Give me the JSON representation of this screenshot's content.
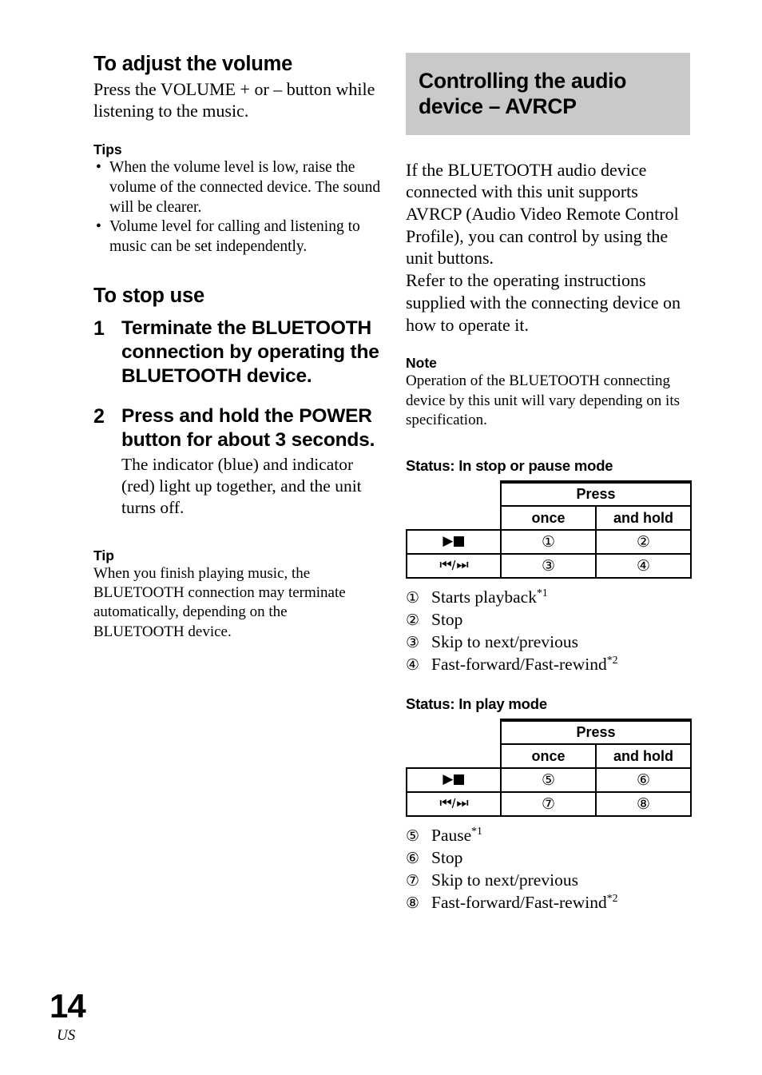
{
  "left_column": {
    "volume_section": {
      "heading": "To adjust the volume",
      "body": "Press the VOLUME + or – button while listening to the music.",
      "tips_heading": "Tips",
      "tips": [
        "When the volume level is low, raise the volume of the connected device. The sound will be clearer.",
        "Volume level for calling and listening to music can be set independently."
      ],
      "bullet_glyph": "•"
    },
    "stop_use_section": {
      "heading": "To stop use",
      "steps": [
        {
          "number": "1",
          "title": "Terminate the BLUETOOTH connection by operating the BLUETOOTH device.",
          "description": ""
        },
        {
          "number": "2",
          "title": "Press and hold the POWER button for about 3 seconds.",
          "description": "The indicator (blue) and indicator (red) light up together, and the unit turns off."
        }
      ],
      "tip_heading": "Tip",
      "tip_body": "When you finish playing music, the BLUETOOTH connection may terminate automatically, depending on the BLUETOOTH device."
    }
  },
  "right_column": {
    "title": "Controlling the audio device – AVRCP",
    "title_color": "#c9c9c9",
    "intro_paragraphs": [
      "If the BLUETOOTH audio device connected with this unit supports AVRCP (Audio Video Remote Control Profile), you can control by using the unit buttons.",
      "Refer to the operating instructions supplied with the connecting device on how to operate it."
    ],
    "note_heading": "Note",
    "note_body": "Operation of the BLUETOOTH connecting device by this unit will vary depending on its specification.",
    "tables": [
      {
        "status_heading": "Status: In stop or pause mode",
        "span_header": "Press",
        "col_headers": [
          "once",
          "and hold"
        ],
        "rows": [
          {
            "label_icon": "play-stop-icon",
            "cells": [
              "①",
              "②"
            ]
          },
          {
            "label_icon": "skip-prev-next-icon",
            "cells": [
              "③",
              "④"
            ]
          }
        ],
        "legend": [
          {
            "marker": "①",
            "text": "Starts playback",
            "footnote": "*1"
          },
          {
            "marker": "②",
            "text": "Stop",
            "footnote": ""
          },
          {
            "marker": "③",
            "text": "Skip to next/previous",
            "footnote": ""
          },
          {
            "marker": "④",
            "text": "Fast-forward/Fast-rewind",
            "footnote": "*2"
          }
        ]
      },
      {
        "status_heading": "Status: In play mode",
        "span_header": "Press",
        "col_headers": [
          "once",
          "and hold"
        ],
        "rows": [
          {
            "label_icon": "play-stop-icon",
            "cells": [
              "⑤",
              "⑥"
            ]
          },
          {
            "label_icon": "skip-prev-next-icon",
            "cells": [
              "⑦",
              "⑧"
            ]
          }
        ],
        "legend": [
          {
            "marker": "⑤",
            "text": "Pause",
            "footnote": "*1"
          },
          {
            "marker": "⑥",
            "text": "Stop",
            "footnote": ""
          },
          {
            "marker": "⑦",
            "text": "Skip to next/previous",
            "footnote": ""
          },
          {
            "marker": "⑧",
            "text": "Fast-forward/Fast-rewind",
            "footnote": "*2"
          }
        ]
      }
    ],
    "icons": {
      "play": "▶",
      "stop": "■",
      "skip_prev": "⏮",
      "skip_next": "⏭",
      "separator": "/"
    }
  },
  "footer": {
    "page_number": "14",
    "region": "US"
  }
}
